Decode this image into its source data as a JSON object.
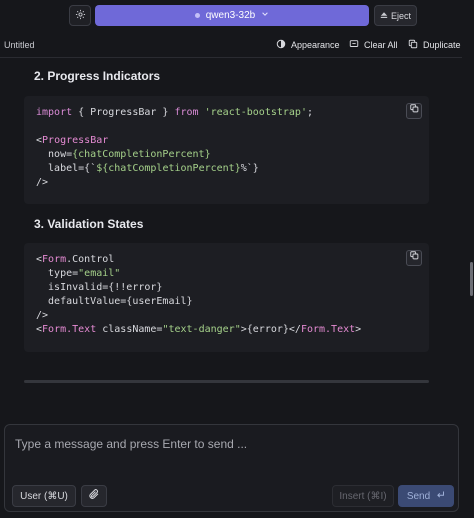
{
  "header": {
    "model_name": "qwen3-32b",
    "eject_label": "Eject"
  },
  "toolbar": {
    "doc_title": "Untitled",
    "appearance_label": "Appearance",
    "clear_all_label": "Clear All",
    "duplicate_label": "Duplicate"
  },
  "content": {
    "section2_heading": "2. Progress Indicators",
    "section3_heading": "3. Validation States",
    "code1": [
      [
        "import { ProgressBar } from ",
        "'react-bootstrap'",
        ";"
      ],
      [
        "<",
        "ProgressBar"
      ],
      [
        "  now=",
        "{chatCompletionPercent}"
      ],
      [
        "  label=",
        "{`${chatCompletionPercent}%`}"
      ],
      [
        "/>"
      ]
    ],
    "code2": [
      [
        "<",
        "Form",
        ".Control"
      ],
      [
        "  type=",
        "\"email\""
      ],
      [
        "  isInvalid={!!error}"
      ],
      [
        "  defaultValue={userEmail}"
      ],
      [
        "/>"
      ],
      [
        "<",
        "Form.Text",
        " className=",
        "\"text-danger\"",
        ">{error}</",
        "Form.Text",
        ">"
      ]
    ]
  },
  "composer": {
    "placeholder": "Type a message and press Enter to send ...",
    "role_label": "User (⌘U)",
    "insert_label": "Insert (⌘I)",
    "send_label": "Send"
  },
  "icons": {
    "settings": "gear-icon",
    "eject": "eject-icon",
    "appearance": "appearance-icon",
    "clear": "clear-icon",
    "duplicate": "duplicate-icon",
    "copy": "copy-icon",
    "attach": "paperclip-icon",
    "enter": "enter-icon"
  },
  "colors": {
    "accent": "#6f69d8",
    "send": "#3b4a74"
  }
}
